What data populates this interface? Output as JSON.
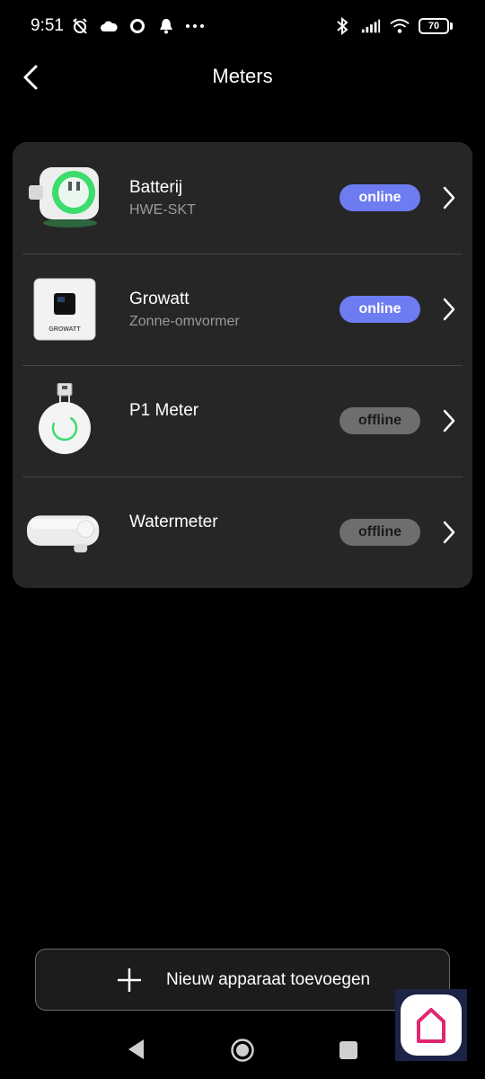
{
  "status_bar": {
    "time": "9:51",
    "battery": "70",
    "left_icons": [
      "alarm-off-icon",
      "cloud-icon",
      "circle-icon",
      "bell-icon",
      "more-dots-icon"
    ],
    "right_icons": [
      "bluetooth-icon",
      "signal-icon",
      "wifi-icon"
    ]
  },
  "header": {
    "title": "Meters"
  },
  "meters": [
    {
      "name": "Batterij",
      "subtitle": "HWE-SKT",
      "status": "online",
      "icon": "smart-plug-icon"
    },
    {
      "name": "Growatt",
      "subtitle": "Zonne-omvormer",
      "status": "online",
      "icon": "growatt-inverter-icon",
      "brand_text": "GROWATT"
    },
    {
      "name": "P1 Meter",
      "subtitle": "",
      "status": "offline",
      "icon": "p1-meter-icon"
    },
    {
      "name": "Watermeter",
      "subtitle": "",
      "status": "offline",
      "icon": "watermeter-icon"
    }
  ],
  "add_button": {
    "label": "Nieuw apparaat toevoegen"
  },
  "colors": {
    "background": "#000000",
    "card": "#262626",
    "online": "#6d7cf0",
    "offline": "#6e6e6e",
    "accent_green": "#3ddc6e",
    "app_pink": "#e0266f"
  }
}
